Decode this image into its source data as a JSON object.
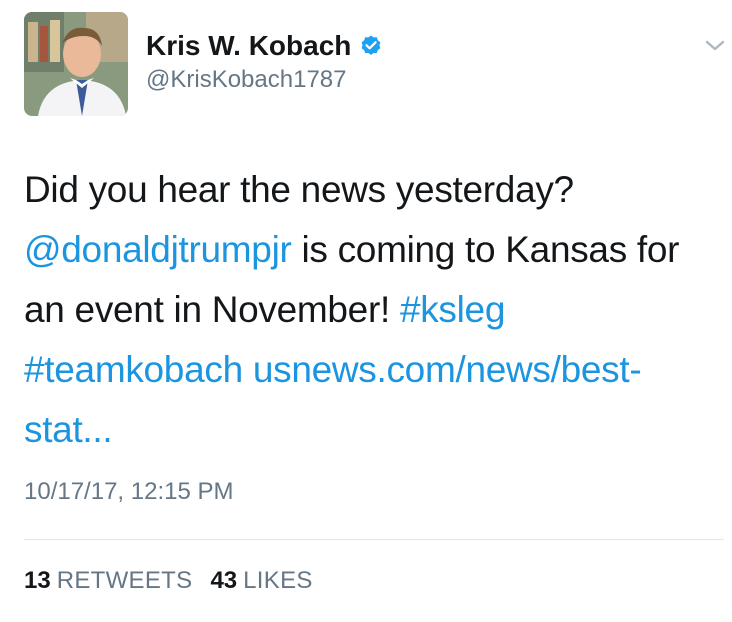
{
  "author": {
    "display_name": "Kris W. Kobach",
    "handle": "@KrisKobach1787",
    "verified": true,
    "avatar_icon": "profile-photo"
  },
  "menu": {
    "icon": "chevron-down-icon"
  },
  "tweet": {
    "text_line1": "Did you hear the news yesterday?",
    "mention": "@donaldjtrumpjr",
    "text_mid": " is coming to Kansas for an event in November! ",
    "hashtag1": "#ksleg",
    "hashtag2": "#teamkobach",
    "link_text": "usnews.com/news/best-stat...",
    "timestamp": "10/17/17, 12:15 PM"
  },
  "stats": {
    "retweets_count": "13",
    "retweets_label": "RETWEETS",
    "likes_count": "43",
    "likes_label": "LIKES"
  },
  "colors": {
    "link": "#1b95e0",
    "text": "#14171a",
    "secondary": "#657786",
    "divider": "#e1e8ed"
  }
}
